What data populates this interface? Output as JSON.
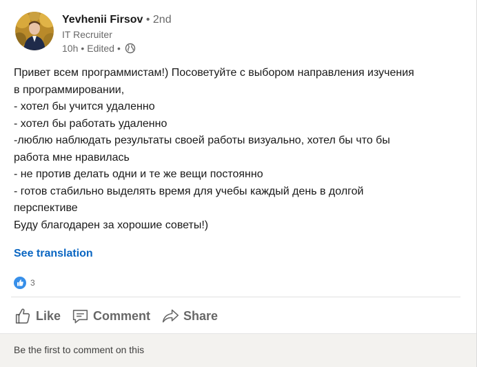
{
  "author": {
    "name": "Yevhenii Firsov",
    "degree": "• 2nd",
    "title": "IT Recruiter",
    "time": "10h",
    "edited": "Edited"
  },
  "post": {
    "lines": [
      "Привет всем программистам!) Посоветуйте с выбором направления  изучения",
      "в программировании,",
      "- хотел бы учится удаленно",
      "- хотел бы работать удаленно",
      "-люблю наблюдать результаты своей работы визуально,  хотел бы что бы",
      "работа мне нравилась",
      "- не против делать одни и те же вещи постоянно",
      "- готов стабильно выделять время для учебы каждый день в долгой",
      "перспективе",
      "Буду благодарен за хорошие советы!)"
    ],
    "see_translation": "See translation"
  },
  "reactions": {
    "count": "3",
    "icon": "like-icon",
    "color": "#378fe9"
  },
  "actions": {
    "like": "Like",
    "comment": "Comment",
    "share": "Share"
  },
  "footer": {
    "text": "Be the first to comment on this"
  },
  "colors": {
    "link": "#0a66c2",
    "footer_bg": "#f3f2ef"
  }
}
